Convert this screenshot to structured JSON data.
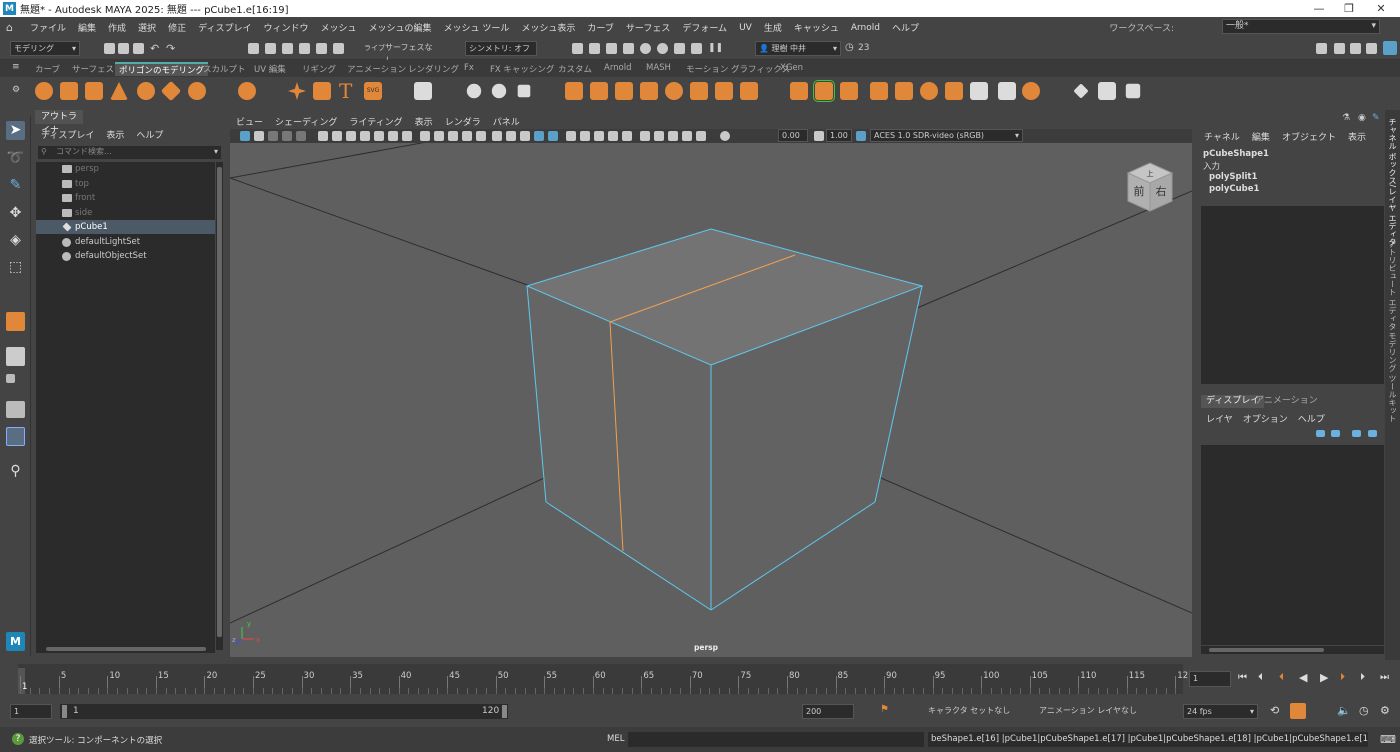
{
  "window": {
    "title": "無題* - Autodesk MAYA 2025: 無題   ---   pCube1.e[16:19]",
    "logo": "M"
  },
  "menu": [
    "ファイル",
    "編集",
    "作成",
    "選択",
    "修正",
    "ディスプレイ",
    "ウィンドウ",
    "メッシュ",
    "メッシュの編集",
    "メッシュ ツール",
    "メッシュ表示",
    "カーブ",
    "サーフェス",
    "デフォーム",
    "UV",
    "生成",
    "キャッシュ",
    "Arnold",
    "ヘルプ"
  ],
  "workspace": {
    "label": "ワークスペース:",
    "value": "一般*"
  },
  "statusline": {
    "mode": "モデリング",
    "live": "ライブ",
    "live_value": "サーフェスなし",
    "symmetry": "シンメトリ: オフ",
    "user": "理樹 中井",
    "credits": "23"
  },
  "shelf_tabs": [
    "カーブ",
    "サーフェス",
    "ポリゴンのモデリング",
    "スカルプト",
    "UV 編集",
    "リギング",
    "アニメーション",
    "レンダリング",
    "Fx",
    "FX キャッシング",
    "カスタム",
    "Arnold",
    "MASH",
    "モーション グラフィックス",
    "XGen"
  ],
  "shelf_active": "ポリゴンのモデリング",
  "outliner": {
    "tab": "アウトライナ",
    "menu": [
      "ディスプレイ",
      "表示",
      "ヘルプ"
    ],
    "search_placeholder": "コマンド検索...",
    "items": [
      {
        "label": "persp",
        "dim": true
      },
      {
        "label": "top",
        "dim": true
      },
      {
        "label": "front",
        "dim": true
      },
      {
        "label": "side",
        "dim": true
      },
      {
        "label": "pCube1",
        "selected": true
      },
      {
        "label": "defaultLightSet"
      },
      {
        "label": "defaultObjectSet"
      }
    ]
  },
  "viewport": {
    "menu": [
      "ビュー",
      "シェーディング",
      "ライティング",
      "表示",
      "レンダラ",
      "パネル"
    ],
    "exposure": "0.00",
    "gamma": "1.00",
    "color_space": "ACES 1.0 SDR-video (sRGB)",
    "camera_label": "persp",
    "viewcube": {
      "front": "前",
      "right": "右",
      "top": "上"
    },
    "colors": {
      "wire": "#5ec8f0",
      "selected_edge": "#f0a050",
      "grid": "#2e2e2e"
    },
    "axis": {
      "x": "x",
      "y": "y",
      "z": "z"
    }
  },
  "channel_box": {
    "menu": [
      "チャネル",
      "編集",
      "オブジェクト",
      "表示"
    ],
    "shape": "pCubeShape1",
    "inputs_label": "入力",
    "inputs": [
      "polySplit1",
      "polyCube1"
    ]
  },
  "layer_editor": {
    "tabs": [
      "ディスプレイ",
      "アニメーション"
    ],
    "menu": [
      "レイヤ",
      "オプション",
      "ヘルプ"
    ]
  },
  "side_tabs": [
    "チャネル ボックス/レイヤ エディタ",
    "アトリビュート エディタ",
    "モデリング ツールキット"
  ],
  "timeline": {
    "labels": [
      "1",
      "5",
      "10",
      "15",
      "20",
      "25",
      "30",
      "35",
      "40",
      "45",
      "50",
      "55",
      "60",
      "65",
      "70",
      "75",
      "80",
      "85",
      "90",
      "95",
      "100",
      "105",
      "110",
      "115",
      "12"
    ],
    "current_frame": "1"
  },
  "range": {
    "start": "1",
    "inner_start": "1",
    "inner_end": "120",
    "end": "200",
    "char_set": "キャラクタ セットなし",
    "anim_layer": "アニメーション レイヤなし",
    "fps": "24 fps"
  },
  "command": {
    "help": "選択ツール: コンポーネントの選択",
    "lang": "MEL",
    "result": "beShape1.e[16] |pCube1|pCubeShape1.e[17] |pCube1|pCubeShape1.e[18] |pCube1|pCubeShape1.e[19];"
  }
}
